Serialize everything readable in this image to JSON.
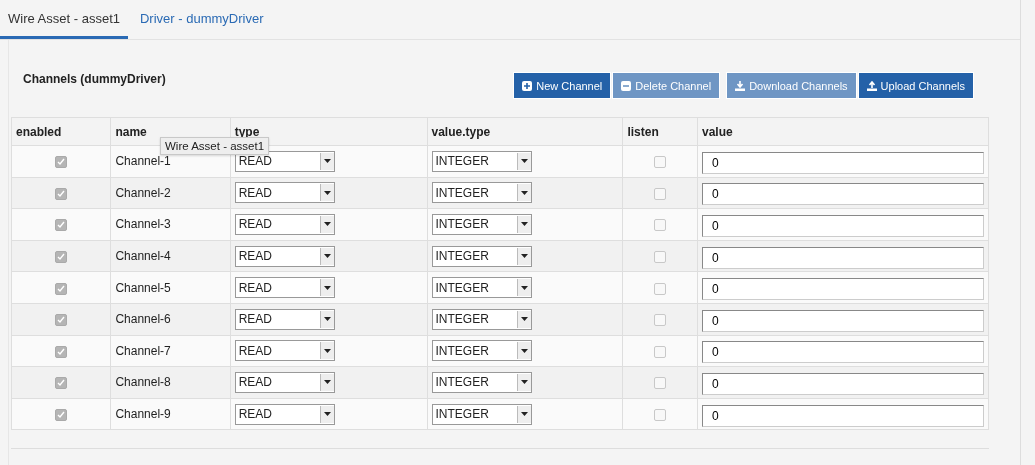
{
  "tabs": [
    {
      "label": "Wire Asset - asset1",
      "selected": true
    },
    {
      "label": "Driver - dummyDriver",
      "selected": false
    }
  ],
  "panel_title": "Channels (dummyDriver)",
  "buttons": [
    {
      "label": "New Channel",
      "kind": "plus",
      "disabled": false
    },
    {
      "label": "Delete Channel",
      "kind": "minus",
      "disabled": true
    },
    {
      "label": "Download Channels",
      "kind": "download",
      "disabled": true
    },
    {
      "label": "Upload Channels",
      "kind": "upload",
      "disabled": false
    }
  ],
  "tooltip": "Wire Asset - asset1",
  "table": {
    "columns": [
      "enabled",
      "name",
      "type",
      "value.type",
      "listen",
      "value"
    ],
    "rows": [
      {
        "enabled": true,
        "name": "Channel-1",
        "type": "READ",
        "value_type": "INTEGER",
        "listen": false,
        "value": "0"
      },
      {
        "enabled": true,
        "name": "Channel-2",
        "type": "READ",
        "value_type": "INTEGER",
        "listen": false,
        "value": "0"
      },
      {
        "enabled": true,
        "name": "Channel-3",
        "type": "READ",
        "value_type": "INTEGER",
        "listen": false,
        "value": "0"
      },
      {
        "enabled": true,
        "name": "Channel-4",
        "type": "READ",
        "value_type": "INTEGER",
        "listen": false,
        "value": "0"
      },
      {
        "enabled": true,
        "name": "Channel-5",
        "type": "READ",
        "value_type": "INTEGER",
        "listen": false,
        "value": "0"
      },
      {
        "enabled": true,
        "name": "Channel-6",
        "type": "READ",
        "value_type": "INTEGER",
        "listen": false,
        "value": "0"
      },
      {
        "enabled": true,
        "name": "Channel-7",
        "type": "READ",
        "value_type": "INTEGER",
        "listen": false,
        "value": "0"
      },
      {
        "enabled": true,
        "name": "Channel-8",
        "type": "READ",
        "value_type": "INTEGER",
        "listen": false,
        "value": "0"
      },
      {
        "enabled": true,
        "name": "Channel-9",
        "type": "READ",
        "value_type": "INTEGER",
        "listen": false,
        "value": "0"
      }
    ]
  }
}
